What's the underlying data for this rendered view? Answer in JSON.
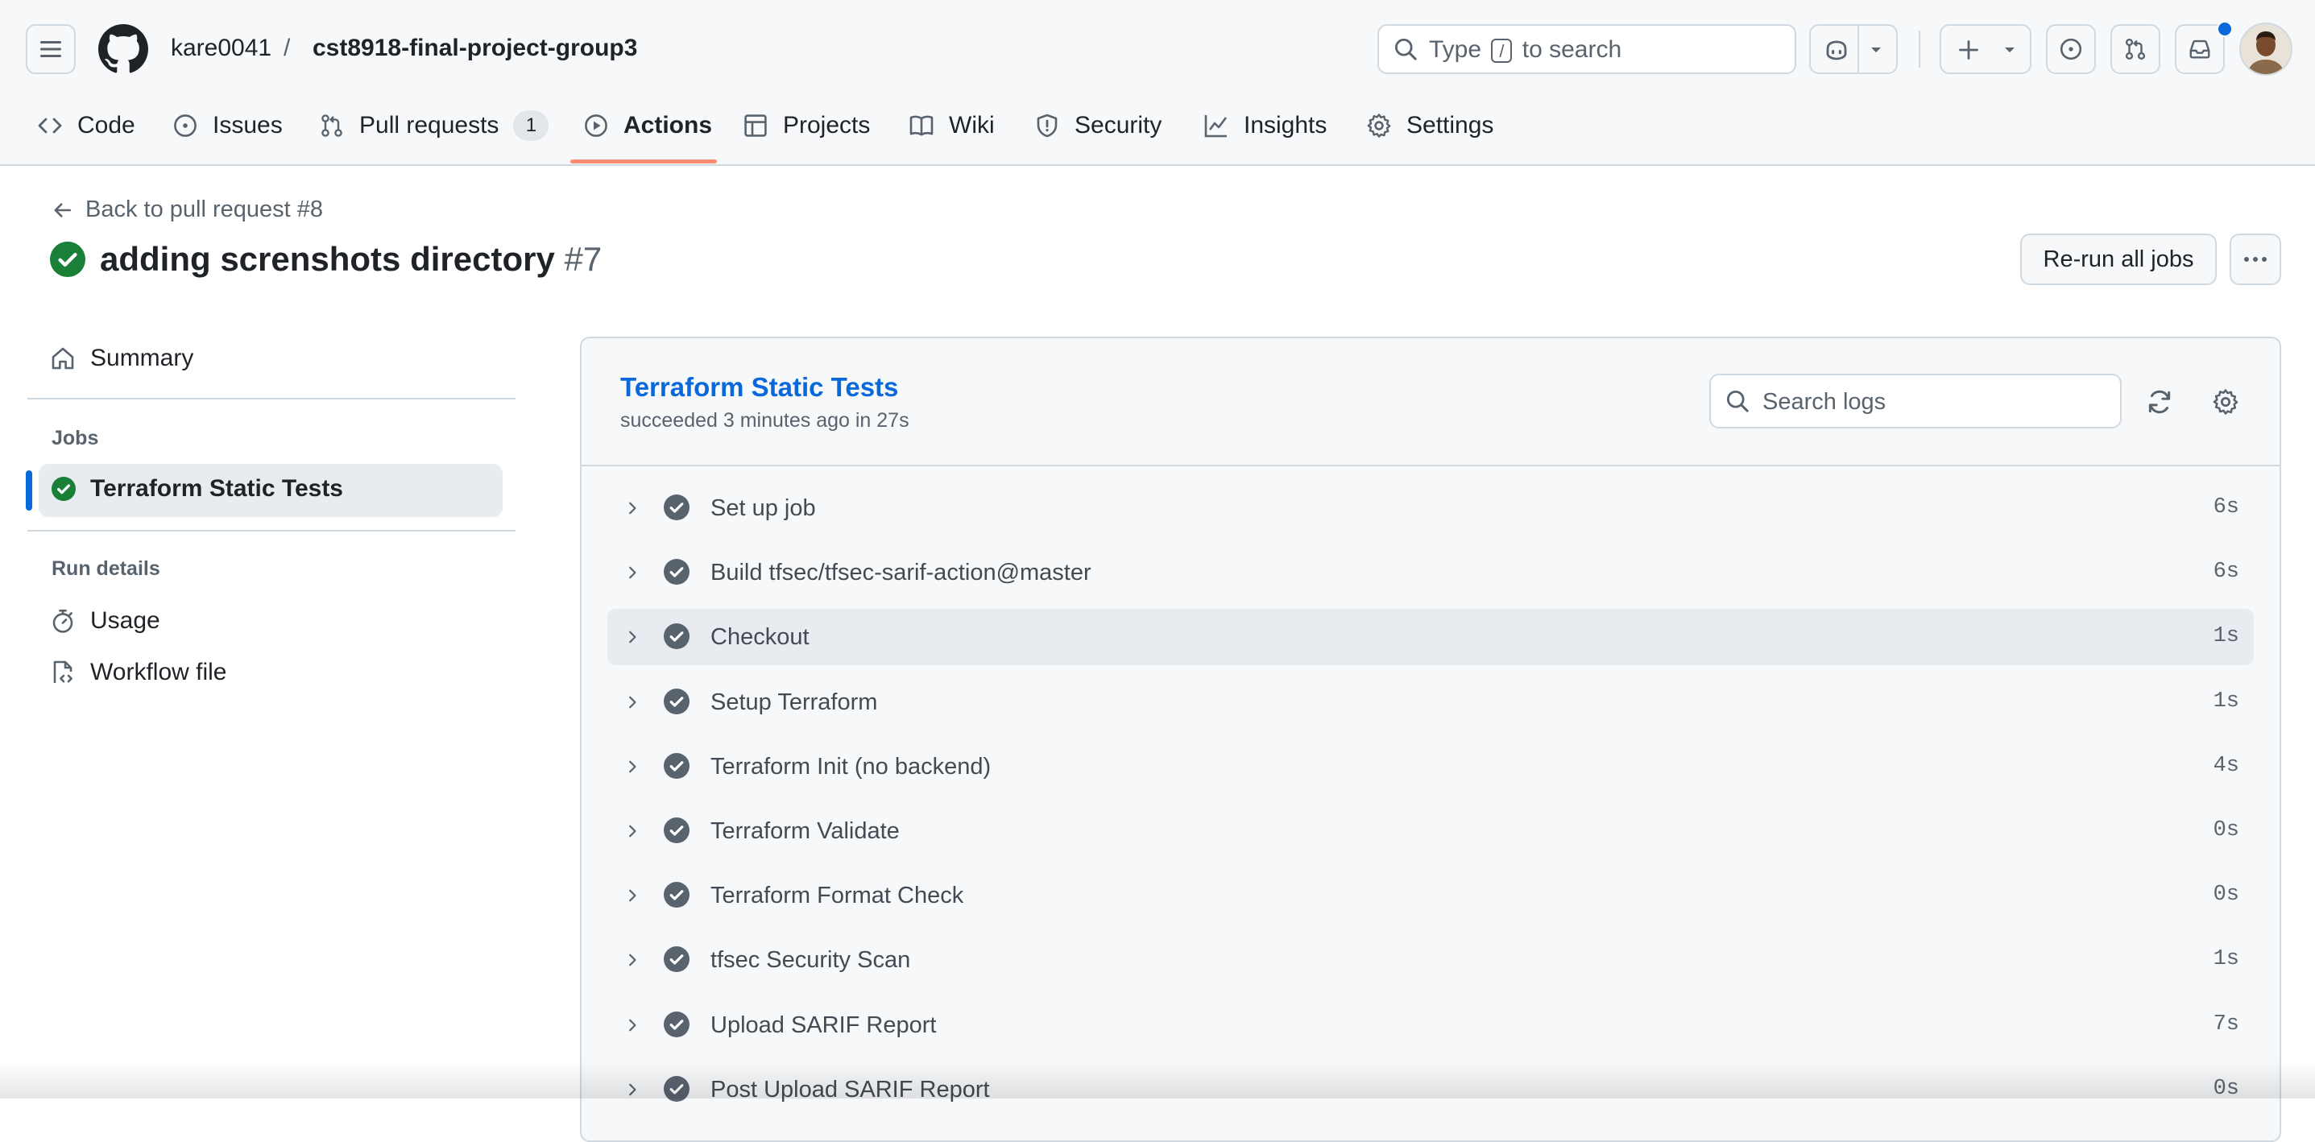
{
  "header": {
    "owner": "kare0041",
    "separator": "/",
    "repo": "cst8918-final-project-group3",
    "search_prefix": "Type",
    "search_key": "/",
    "search_suffix": "to search"
  },
  "tabs": [
    {
      "label": "Code"
    },
    {
      "label": "Issues"
    },
    {
      "label": "Pull requests",
      "count": "1"
    },
    {
      "label": "Actions"
    },
    {
      "label": "Projects"
    },
    {
      "label": "Wiki"
    },
    {
      "label": "Security"
    },
    {
      "label": "Insights"
    },
    {
      "label": "Settings"
    }
  ],
  "run": {
    "back_label": "Back to pull request #8",
    "title": "adding screnshots directory",
    "number": "#7",
    "rerun_label": "Re-run all jobs"
  },
  "sidebar": {
    "summary": "Summary",
    "jobs_heading": "Jobs",
    "job": "Terraform Static Tests",
    "run_details_heading": "Run details",
    "usage": "Usage",
    "workflow_file": "Workflow file"
  },
  "job": {
    "title": "Terraform Static Tests",
    "subtitle": "succeeded 3 minutes ago in 27s",
    "search_placeholder": "Search logs"
  },
  "steps": [
    {
      "name": "Set up job",
      "duration": "6s"
    },
    {
      "name": "Build tfsec/tfsec-sarif-action@master",
      "duration": "6s"
    },
    {
      "name": "Checkout",
      "duration": "1s"
    },
    {
      "name": "Setup Terraform",
      "duration": "1s"
    },
    {
      "name": "Terraform Init (no backend)",
      "duration": "4s"
    },
    {
      "name": "Terraform Validate",
      "duration": "0s"
    },
    {
      "name": "Terraform Format Check",
      "duration": "0s"
    },
    {
      "name": "tfsec Security Scan",
      "duration": "1s"
    },
    {
      "name": "Upload SARIF Report",
      "duration": "7s"
    },
    {
      "name": "Post Upload SARIF Report",
      "duration": "0s"
    }
  ],
  "colors": {
    "success": "#1a7f37",
    "link": "#0969da",
    "tab_underline": "#fd8c73",
    "notification_dot": "#0969da"
  }
}
